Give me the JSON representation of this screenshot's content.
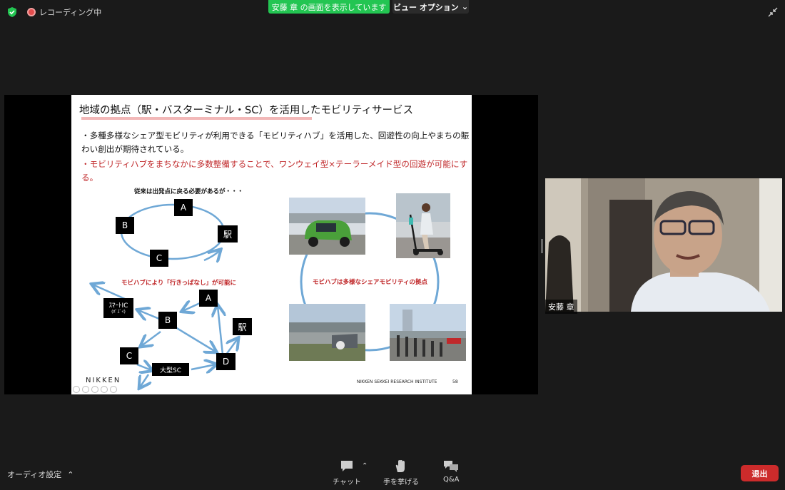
{
  "topbar": {
    "recording_label": "レコーディング中",
    "share_banner": "安藤 章 の画面を表示しています",
    "view_options": "ビュー オプション"
  },
  "slide": {
    "title": "地域の拠点（駅・バスターミナル・SC）を活用したモビリティサービス",
    "bullet1": "・多種多様なシェア型モビリティが利用できる「モビリティハブ」を活用した、回遊性の向上やまちの賑わい創出が期待されている。",
    "bullet2": "・モビリティハブをまちなかに多数整備することで、ワンウェイ型×テーラーメイド型の回遊が可能にする。",
    "caption_top": "従来は出発点に戻る必要があるが・・・",
    "caption_bottom": "モビハブにより「行きっぱなし」が可能に",
    "caption_right": "モビハブは多様なシェアモビリティの拠点",
    "nodes_top": {
      "a": "A",
      "b": "B",
      "c": "C",
      "station": "駅"
    },
    "nodes_bottom": {
      "a": "A",
      "b": "B",
      "c": "C",
      "d": "D",
      "station": "駅",
      "smart_ic": "ｽﾏｰﾄIC",
      "smart_ic_sub": "(ﾎﾟｽﾞｲ)",
      "sc": "大型SC"
    },
    "logo": "NIKKEN",
    "footer": "NIKKEN SEKKEI RESEARCH INSTITUTE",
    "page": "58"
  },
  "participant": {
    "name": "安藤 章"
  },
  "toolbar": {
    "audio_settings": "オーディオ設定",
    "chat": "チャット",
    "raise_hand": "手を挙げる",
    "qa": "Q&A",
    "leave": "退出"
  },
  "colors": {
    "share_green": "#23c552",
    "leave_red": "#cc2b2b",
    "slide_red": "#c0282a",
    "arrow_blue": "#6fa8d6"
  }
}
